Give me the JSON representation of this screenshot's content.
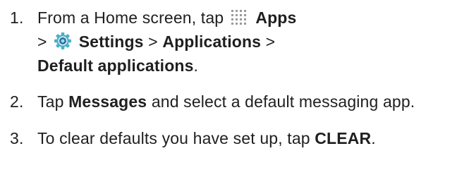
{
  "steps": [
    {
      "number": "1.",
      "t1": "From a Home screen, tap",
      "apps_icon": "apps-grid-icon",
      "apps": "Apps",
      "sep1": ">",
      "settings_icon": "settings-gear-icon",
      "settings": "Settings",
      "sep2": ">",
      "applications": "Applications",
      "sep3": ">",
      "default_apps": "Default applications",
      "end": "."
    },
    {
      "number": "2.",
      "t1": "Tap",
      "messages": "Messages",
      "t2": "and select a default messaging app."
    },
    {
      "number": "3.",
      "t1": "To clear defaults you have set up, tap",
      "clear": "CLEAR",
      "end": "."
    }
  ],
  "colors": {
    "text": "#1f1f1f",
    "apps_icon_dots": "#9a9a9a",
    "settings_icon_ring": "#49b0c6",
    "settings_icon_fill": "#2b6f9e"
  }
}
